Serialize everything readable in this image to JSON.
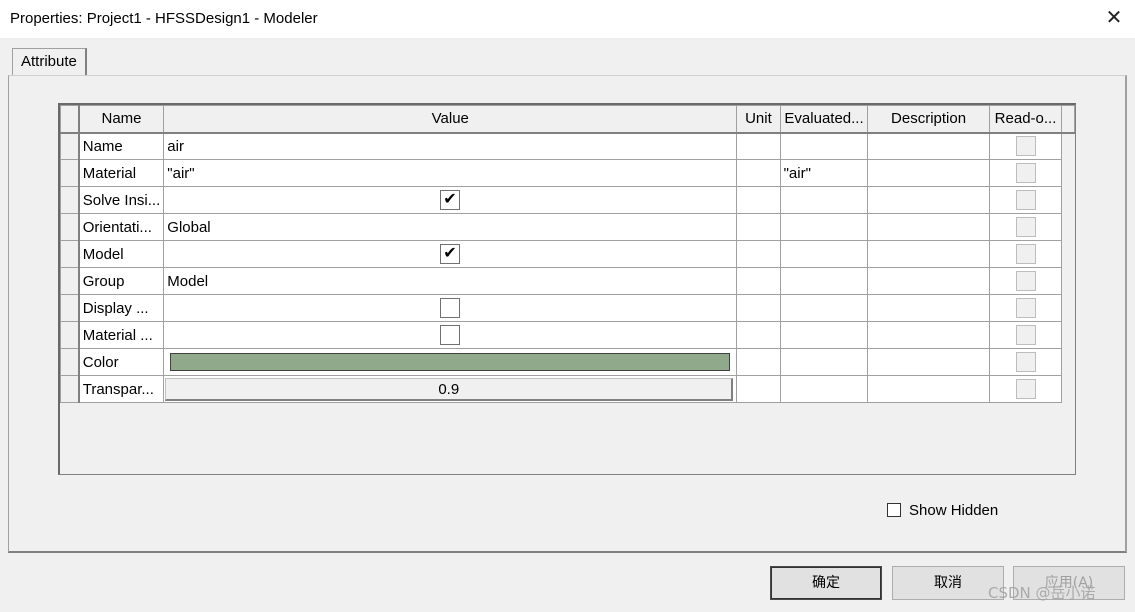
{
  "window": {
    "title": "Properties: Project1 - HFSSDesign1 - Modeler",
    "close_glyph": "✕"
  },
  "tabs": [
    {
      "label": "Attribute"
    }
  ],
  "grid": {
    "columns": [
      "Name",
      "Value",
      "Unit",
      "Evaluated...",
      "Description",
      "Read-o..."
    ],
    "rows": [
      {
        "name": "Name",
        "value": "air",
        "evaluated": ""
      },
      {
        "name": "Material",
        "value": "\"air\"",
        "evaluated": "\"air\""
      },
      {
        "name": "Solve Insi...",
        "checked": true
      },
      {
        "name": "Orientati...",
        "value": "Global"
      },
      {
        "name": "Model",
        "checked": true
      },
      {
        "name": "Group",
        "value": "Model"
      },
      {
        "name": "Display ...",
        "checked": false
      },
      {
        "name": "Material ...",
        "checked": false
      },
      {
        "name": "Color",
        "color": "#8fa98a"
      },
      {
        "name": "Transpar...",
        "value": "0.9"
      }
    ]
  },
  "show_hidden": {
    "label": "Show Hidden",
    "checked": false
  },
  "buttons": {
    "ok": "确定",
    "cancel": "取消",
    "apply": "应用(A)"
  },
  "watermark": "CSDN @岳小诺"
}
